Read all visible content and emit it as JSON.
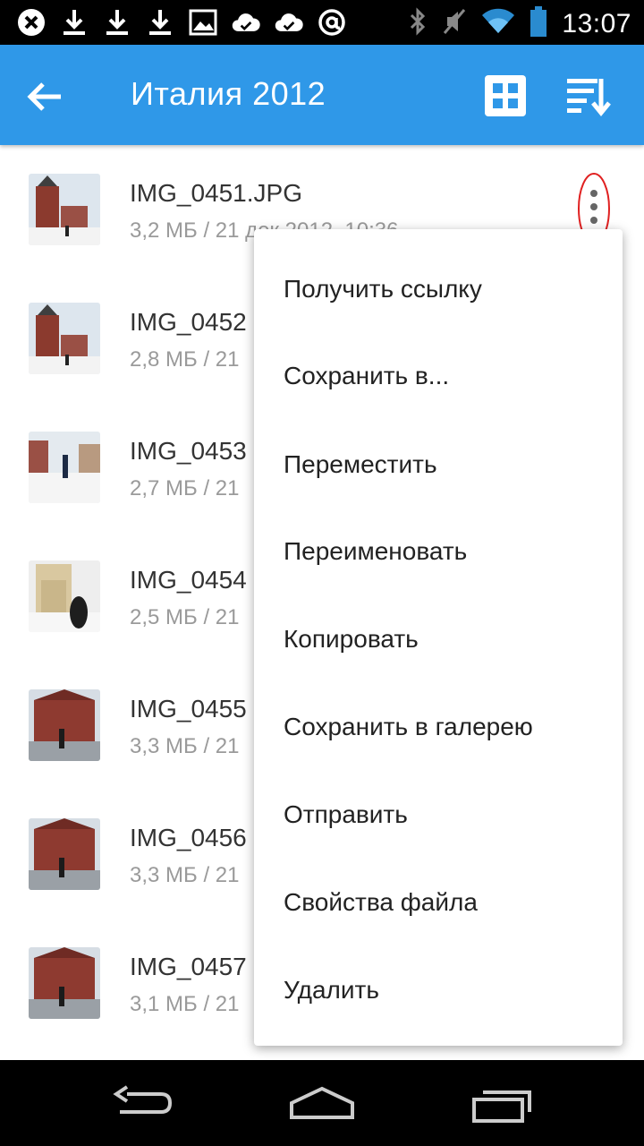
{
  "status_bar": {
    "time": "13:07"
  },
  "app_bar": {
    "title": "Италия 2012"
  },
  "files": [
    {
      "name": "IMG_0451.JPG",
      "meta": "3,2 МБ / 21 дек 2012, 10:36"
    },
    {
      "name": "IMG_0452",
      "meta": "2,8 МБ / 21"
    },
    {
      "name": "IMG_0453",
      "meta": "2,7 МБ / 21"
    },
    {
      "name": "IMG_0454",
      "meta": "2,5 МБ / 21"
    },
    {
      "name": "IMG_0455",
      "meta": "3,3 МБ / 21"
    },
    {
      "name": "IMG_0456",
      "meta": "3,3 МБ / 21"
    },
    {
      "name": "IMG_0457",
      "meta": "3,1 МБ / 21"
    }
  ],
  "context_menu": {
    "items": [
      "Получить ссылку",
      "Сохранить в...",
      "Переместить",
      "Переименовать",
      "Копировать",
      "Сохранить в галерею",
      "Отправить",
      "Свойства файла",
      "Удалить"
    ],
    "highlighted_index": 2,
    "highlight_color": "#fdfc5a"
  },
  "colors": {
    "app_bar": "#2f98e8",
    "annotation_circle": "#e02020"
  },
  "icons": {
    "status_left": [
      "close-circle-icon",
      "download-icon",
      "download-icon",
      "download-icon",
      "image-icon",
      "cloud-done-icon",
      "cloud-done-icon",
      "at-sign-icon"
    ],
    "status_right": [
      "bluetooth-icon",
      "mute-icon",
      "wifi-icon",
      "battery-icon"
    ],
    "app_bar": [
      "back-arrow-icon",
      "grid-view-icon",
      "sort-icon"
    ],
    "row": "more-vert-icon",
    "nav": [
      "back-icon",
      "home-icon",
      "recents-icon"
    ]
  }
}
